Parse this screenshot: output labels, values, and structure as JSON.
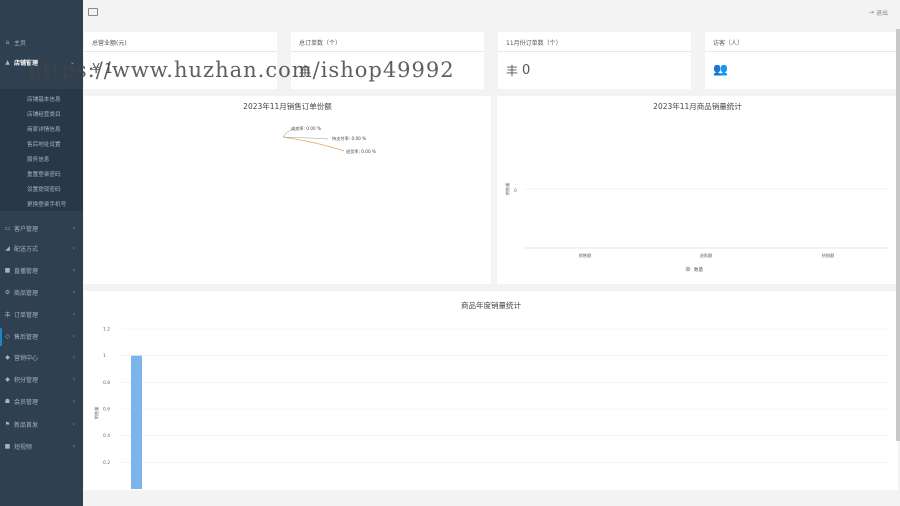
{
  "header": {
    "logout_label": "退出"
  },
  "sidebar": {
    "items": [
      {
        "icon": "home-icon",
        "glyph": "⌂",
        "label": "主页",
        "chevron": ""
      },
      {
        "icon": "store-icon",
        "glyph": "▲",
        "label": "店铺管理",
        "chevron": "⌄"
      },
      {
        "icon": "card-icon",
        "glyph": "▭",
        "label": "客户管理",
        "chevron": "‹"
      },
      {
        "icon": "truck-icon",
        "glyph": "◢",
        "label": "配送方式",
        "chevron": "‹"
      },
      {
        "icon": "video-icon",
        "glyph": "■",
        "label": "直播管理",
        "chevron": "‹"
      },
      {
        "icon": "gear-icon",
        "glyph": "⚙",
        "label": "商品管理",
        "chevron": "‹"
      },
      {
        "icon": "order-icon",
        "glyph": "丰",
        "label": "订单管理",
        "chevron": "‹"
      },
      {
        "icon": "aftersale-icon",
        "glyph": "◇",
        "label": "售后管理",
        "chevron": "‹"
      },
      {
        "icon": "marketing-icon",
        "glyph": "◆",
        "label": "营销中心",
        "chevron": "‹"
      },
      {
        "icon": "points-icon",
        "glyph": "◆",
        "label": "积分管理",
        "chevron": "‹"
      },
      {
        "icon": "members-icon",
        "glyph": "☗",
        "label": "会员管理",
        "chevron": "‹"
      },
      {
        "icon": "flag-icon",
        "glyph": "⚑",
        "label": "新品首发",
        "chevron": "‹"
      },
      {
        "icon": "camera-icon",
        "glyph": "■",
        "label": "短视频",
        "chevron": "‹"
      }
    ],
    "submenu": [
      "店铺基本信息",
      "店铺经营类目",
      "商家详情信息",
      "售后地址设置",
      "服务信息",
      "重置登录密码",
      "设置提现密码",
      "更换登录手机号"
    ]
  },
  "stats": [
    {
      "title": "总营业额(元)",
      "value": "¥ 1",
      "icon": "yen-icon"
    },
    {
      "title": "总订单数（个）",
      "value": "",
      "icon": "order-icon",
      "glyph": "丰"
    },
    {
      "title": "11月份订单数（个）",
      "value": "0",
      "icon": "order-icon",
      "glyph": "丰"
    },
    {
      "title": "访客（人）",
      "value": "",
      "icon": "users-icon",
      "glyph": "👥"
    }
  ],
  "watermark": "https://www.huzhan.com/ishop49992",
  "pie_panel": {
    "title": "2023年11月销售订单份额",
    "labels": [
      "成交率: 0.00 %",
      "待支付率: 0.00 %",
      "退货率: 0.00 %"
    ]
  },
  "bar_panel": {
    "title": "2023年11月商品销量统计",
    "ylabel": "销售量",
    "ytick": "0",
    "legend": "数量"
  },
  "year_panel": {
    "title": "商品年度销量统计",
    "ylabel": "销售量",
    "yticks": [
      "1.2",
      "1",
      "0.8",
      "0.6",
      "0.4",
      "0.2"
    ]
  },
  "chart_data": [
    {
      "type": "pie",
      "title": "2023年11月销售订单份额",
      "categories": [
        "成交率",
        "待支付率",
        "退货率"
      ],
      "values": [
        0,
        0,
        0
      ]
    },
    {
      "type": "bar",
      "title": "2023年11月商品销量统计",
      "ylabel": "销售量",
      "categories": [
        "销售额",
        "退款额",
        "热销额"
      ],
      "values": [
        0,
        0,
        0
      ],
      "series": [
        {
          "name": "数量",
          "values": [
            0,
            0,
            0
          ]
        }
      ]
    },
    {
      "type": "bar",
      "title": "商品年度销量统计",
      "ylabel": "销售量",
      "ylim": [
        0,
        1.2
      ],
      "categories": [
        ""
      ],
      "values": [
        1
      ]
    }
  ]
}
